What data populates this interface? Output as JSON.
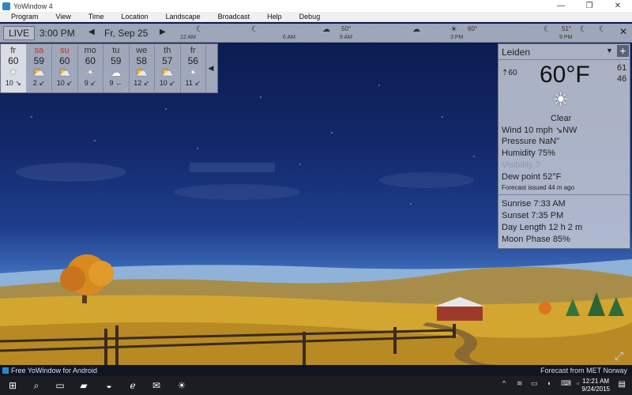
{
  "window": {
    "title": "YoWindow 4"
  },
  "menu": [
    "Program",
    "View",
    "Time",
    "Location",
    "Landscape",
    "Broadcast",
    "Help",
    "Debug"
  ],
  "timebar": {
    "live_label": "LIVE",
    "time": "3:00 PM",
    "date": "Fr, Sep 25",
    "ticks": [
      "12 AM",
      "6 AM",
      "9 AM",
      "3 PM",
      "9 PM"
    ],
    "temps": [
      "50°",
      "60°",
      "51°"
    ]
  },
  "forecast": [
    {
      "day": "fr",
      "temp": "60",
      "icon": "sun-icon",
      "wind": "10 ↘",
      "weekend": false,
      "selected": true
    },
    {
      "day": "sa",
      "temp": "59",
      "icon": "sun-cloud-icon",
      "wind": "2 ↙",
      "weekend": true
    },
    {
      "day": "su",
      "temp": "60",
      "icon": "sun-cloud-icon",
      "wind": "10 ↙",
      "weekend": true
    },
    {
      "day": "mo",
      "temp": "60",
      "icon": "sun-icon",
      "wind": "9 ↙",
      "weekend": false
    },
    {
      "day": "tu",
      "temp": "59",
      "icon": "cloud-icon",
      "wind": "9 ←",
      "weekend": false
    },
    {
      "day": "we",
      "temp": "58",
      "icon": "sun-cloud-icon",
      "wind": "12 ↙",
      "weekend": false
    },
    {
      "day": "th",
      "temp": "57",
      "icon": "sun-cloud-icon",
      "wind": "10 ↙",
      "weekend": false
    },
    {
      "day": "fr",
      "temp": "56",
      "icon": "sun-icon",
      "wind": "11 ↙",
      "weekend": false
    }
  ],
  "panel": {
    "location": "Leiden",
    "feels_like": "60",
    "temperature": "60°F",
    "high": "61",
    "low": "46",
    "condition": "Clear",
    "wind": "Wind  10 mph ↘NW",
    "pressure": "Pressure  NaN\"",
    "humidity": "Humidity  75%",
    "visibility": "Visibility  ?",
    "dew_point": "Dew point  52°F",
    "forecast_issued": "Forecast issued  44 m ago",
    "sunrise": "Sunrise  7:33 AM",
    "sunset": "Sunset  7:35 PM",
    "day_length": "Day Length  12 h 2 m",
    "moon_phase": "Moon Phase  85%"
  },
  "appbar": {
    "promo": "Free YoWindow for Android",
    "source": "Forecast from MET Norway"
  },
  "taskbar": {
    "time": "12:21 AM",
    "date": "9/24/2015"
  },
  "colors": {
    "sky_top": "#0a1a4c",
    "field": "#d3a630",
    "panel_bg": "#cdd2dc",
    "weekend": "#b23a2a"
  }
}
